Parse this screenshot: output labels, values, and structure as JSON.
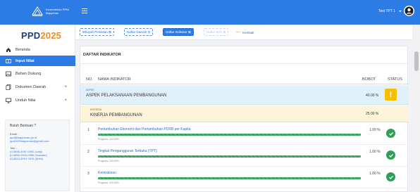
{
  "topbar": {
    "brand_text": "Kementerian PPN/ Bappenas",
    "user_name": "Test TPT 1",
    "accent_color": "#2d7be5"
  },
  "sidebar": {
    "logo_prefix": "PPD",
    "logo_suffix": "2025",
    "items": [
      {
        "label": "Beranda",
        "icon": "home-icon"
      },
      {
        "label": "Input Nilai",
        "icon": "columns-icon",
        "active": true
      },
      {
        "label": "Bahan Dukung",
        "icon": "image-icon"
      },
      {
        "label": "Dokumen Daerah",
        "icon": "copy-icon",
        "plus": "+"
      },
      {
        "label": "Unduh Nilai",
        "icon": "monitor-icon",
        "plus": "+"
      }
    ],
    "help": {
      "title": "Butuh Bantuan ?",
      "email_label": "Email :",
      "emails": [
        "ppd@bappenas.go.id",
        "ppd2025bappenas@gmail.com"
      ],
      "tele_label": "Tele :",
      "phones": [
        "(0-0856-4097-0092 (Lolly)",
        "(0-0856-0303-0556 (Husnain)",
        "(0-0815-3919-7876 (Anim)"
      ]
    }
  },
  "filters": {
    "chips": [
      "Wilayah Penilaian ⊠",
      "Daftar Daerah ⊡",
      "Daftar Indikator ⊠",
      "Daftar Item ⊠"
    ],
    "back_label": "Kembali"
  },
  "card": {
    "title": "DAFTAR INDIKATOR",
    "headers": {
      "no": "NO.",
      "name": "NAMA INDIKATOR",
      "bobot": "BOBOT",
      "status": "STATUS"
    },
    "aspek": {
      "label": "ASPEK",
      "title": "ASPEK PELAKSANAAN PEMBANGUNAN",
      "bobot": "40.00 %",
      "warn": "!"
    },
    "kriteria": {
      "label": "KRITERIA",
      "title": "KINERJA PEMBANGUNAN",
      "bobot": "25.00 %"
    },
    "indicators": [
      {
        "no": "1",
        "name": "Pertumbuhan Ekonomi dan Pertumbuhan PDRB per Kapita",
        "progress_text": "Progress: 100.00%",
        "progress": 100,
        "bobot": "1.00 %"
      },
      {
        "no": "2",
        "name": "Tingkat Pengangguran Terbuka (TPT)",
        "progress_text": "Progress: 100.00%",
        "progress": 100,
        "bobot": "1.00 %"
      },
      {
        "no": "3",
        "name": "Kemiskinan",
        "progress_text": "Progress: 100.00%",
        "progress": 100,
        "bobot": "1.00 %"
      }
    ]
  }
}
